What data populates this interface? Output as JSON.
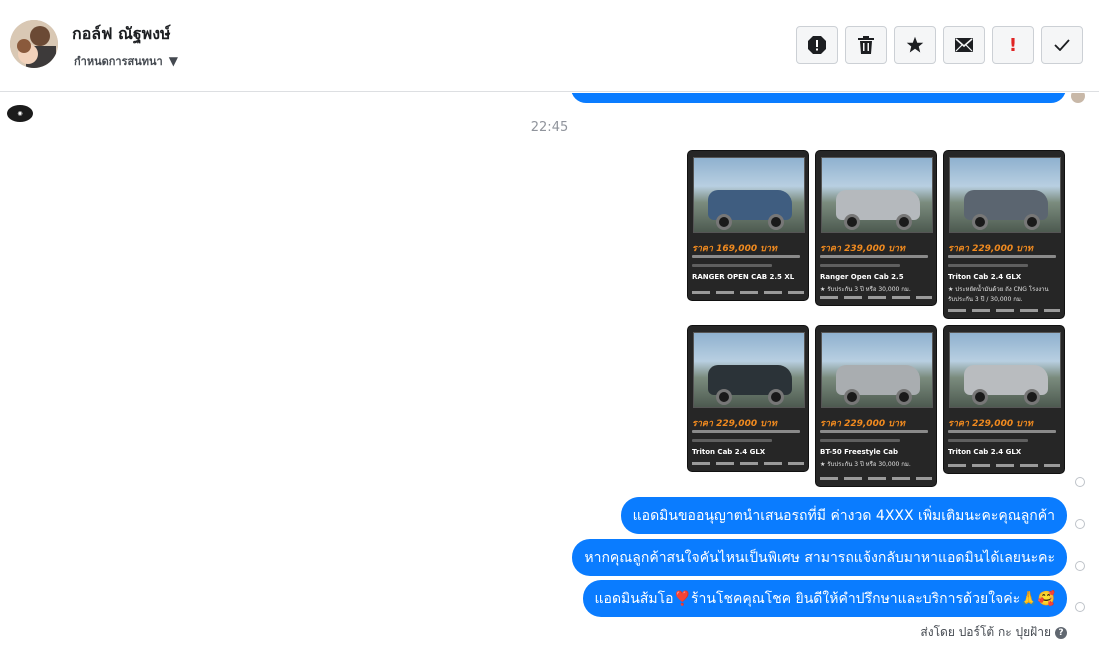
{
  "header": {
    "contact_name": "กอล์ฟ ณัฐพงษ์",
    "subtitle": "กำหนดการสนทนา",
    "tools": [
      {
        "icon": "report-icon"
      },
      {
        "icon": "trash-icon"
      },
      {
        "icon": "star-icon"
      },
      {
        "icon": "envelope-icon"
      },
      {
        "icon": "priority-icon",
        "label": "!"
      },
      {
        "icon": "checkmark-icon"
      }
    ]
  },
  "thread": {
    "timestamp": "22:45",
    "cards": [
      {
        "price": "ราคา 169,000 บาท",
        "model": "RANGER OPEN CAB 2.5 XL",
        "feature": "",
        "paint": "#3f5d80"
      },
      {
        "price": "ราคา 239,000 บาท",
        "model": "Ranger Open Cab 2.5",
        "feature": "★ รับประกัน 3 ปี หรือ 30,000 กม.",
        "paint": "#b5b9bd"
      },
      {
        "price": "ราคา 229,000 บาท",
        "model": "Triton Cab 2.4 GLX",
        "feature": "★ ประหยัดน้ำมันด้วย ถัง CNG โรงงาน",
        "feature2": "รับประกัน 3 ปี / 30,000 กม.",
        "paint": "#5b6570"
      },
      {
        "price": "ราคา 229,000 บาท",
        "model": "Triton Cab 2.4 GLX",
        "feature": "",
        "paint": "#2b3338"
      },
      {
        "price": "ราคา 229,000 บาท",
        "model": "BT-50 Freestyle Cab",
        "feature": "★ รับประกัน 3 ปี หรือ 30,000 กม.",
        "paint": "#a9adb0"
      },
      {
        "price": "ราคา 229,000 บาท",
        "model": "Triton Cab 2.4 GLX",
        "feature": "",
        "paint": "#b9bcbf"
      }
    ],
    "messages": [
      "แอดมินขออนุญาตนำเสนอรถที่มี ค่างวด 4XXX เพิ่มเติมนะคะคุณลูกค้า",
      "หากคุณลูกค้าสนใจคันไหนเป็นพิเศษ สามารถแจ้งกลับมาหาแอดมินได้เลยนะคะ",
      {
        "before": "แอดมินส้มโอ",
        "heart": "❣️",
        "after": " ร้านโชคคุณโชค ยินดีให้คำปรึกษาและบริการด้วยใจค่ะ🙏🥰"
      }
    ],
    "sent_by": "ส่งโดย ปอร์โต้ กะ ปุยฝ้าย",
    "help_glyph": "?"
  },
  "colors": {
    "bubble": "#0a7cff",
    "price": "#f08a1f",
    "card_bg": "#262626"
  }
}
